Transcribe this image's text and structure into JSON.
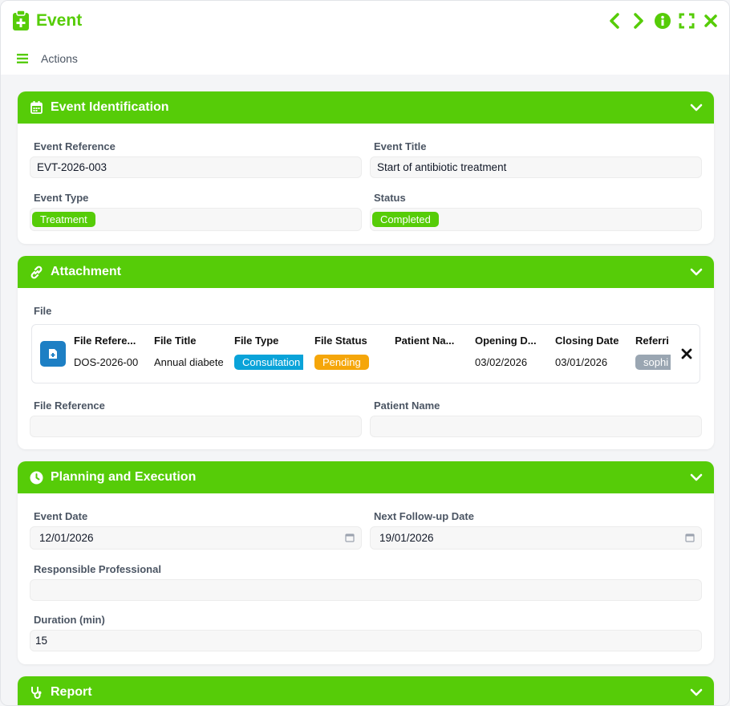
{
  "window": {
    "title": "Event",
    "actions_label": "Actions"
  },
  "colors": {
    "accent": "#56cc08",
    "consultation": "#0aa3d9",
    "pending": "#f5a60a",
    "referrer": "#9aa6b2",
    "file_icon": "#1d7fc4"
  },
  "identification": {
    "title": "Event Identification",
    "reference_label": "Event Reference",
    "reference_value": "EVT-2026-003",
    "title_label": "Event Title",
    "title_value": "Start of antibiotic treatment",
    "type_label": "Event Type",
    "type_value": "Treatment",
    "status_label": "Status",
    "status_value": "Completed"
  },
  "attachment": {
    "title": "Attachment",
    "file_label": "File",
    "columns": [
      "File Refere...",
      "File Title",
      "File Type",
      "File Status",
      "Patient Na...",
      "Opening D...",
      "Closing Date",
      "Referri"
    ],
    "row": {
      "reference": "DOS-2026-00",
      "title": "Annual diabete",
      "type": "Consultation",
      "status": "Pending",
      "patient": "",
      "opening": "03/02/2026",
      "closing": "03/01/2026",
      "referrer": "sophi"
    },
    "file_reference_label": "File Reference",
    "file_reference_value": "",
    "patient_name_label": "Patient Name",
    "patient_name_value": ""
  },
  "planning": {
    "title": "Planning and Execution",
    "event_date_label": "Event Date",
    "event_date_value": "12/01/2026",
    "followup_label": "Next Follow-up Date",
    "followup_value": "19/01/2026",
    "professional_label": "Responsible Professional",
    "professional_value": "",
    "duration_label": "Duration (min)",
    "duration_value": "15"
  },
  "report": {
    "title": "Report"
  },
  "icons": [
    "clipboard-plus-icon",
    "chevron-left-icon",
    "chevron-right-icon",
    "info-icon",
    "expand-icon",
    "close-icon",
    "menu-icon",
    "calendar-icon",
    "link-icon",
    "clock-icon",
    "stethoscope-icon",
    "chevron-down-icon",
    "file-icon",
    "remove-icon"
  ]
}
